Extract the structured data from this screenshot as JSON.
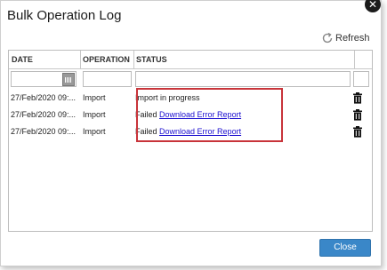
{
  "dialog": {
    "title": "Bulk Operation Log",
    "close_icon": "close-icon",
    "refresh_label": "Refresh",
    "close_button_label": "Close"
  },
  "table": {
    "headers": [
      "DATE",
      "OPERATION",
      "STATUS"
    ],
    "rows": [
      {
        "date": "27/Feb/2020 09:...",
        "operation": "Import",
        "status_text": "Import in progress",
        "link": ""
      },
      {
        "date": "27/Feb/2020 09:...",
        "operation": "Import",
        "status_text": "Failed",
        "link": "Download Error Report"
      },
      {
        "date": "27/Feb/2020 09:...",
        "operation": "Import",
        "status_text": "Failed",
        "link": "Download Error Report"
      }
    ]
  },
  "colors": {
    "accent": "#3a87c8",
    "highlight": "#c8343a",
    "link": "#1a0dcf"
  }
}
